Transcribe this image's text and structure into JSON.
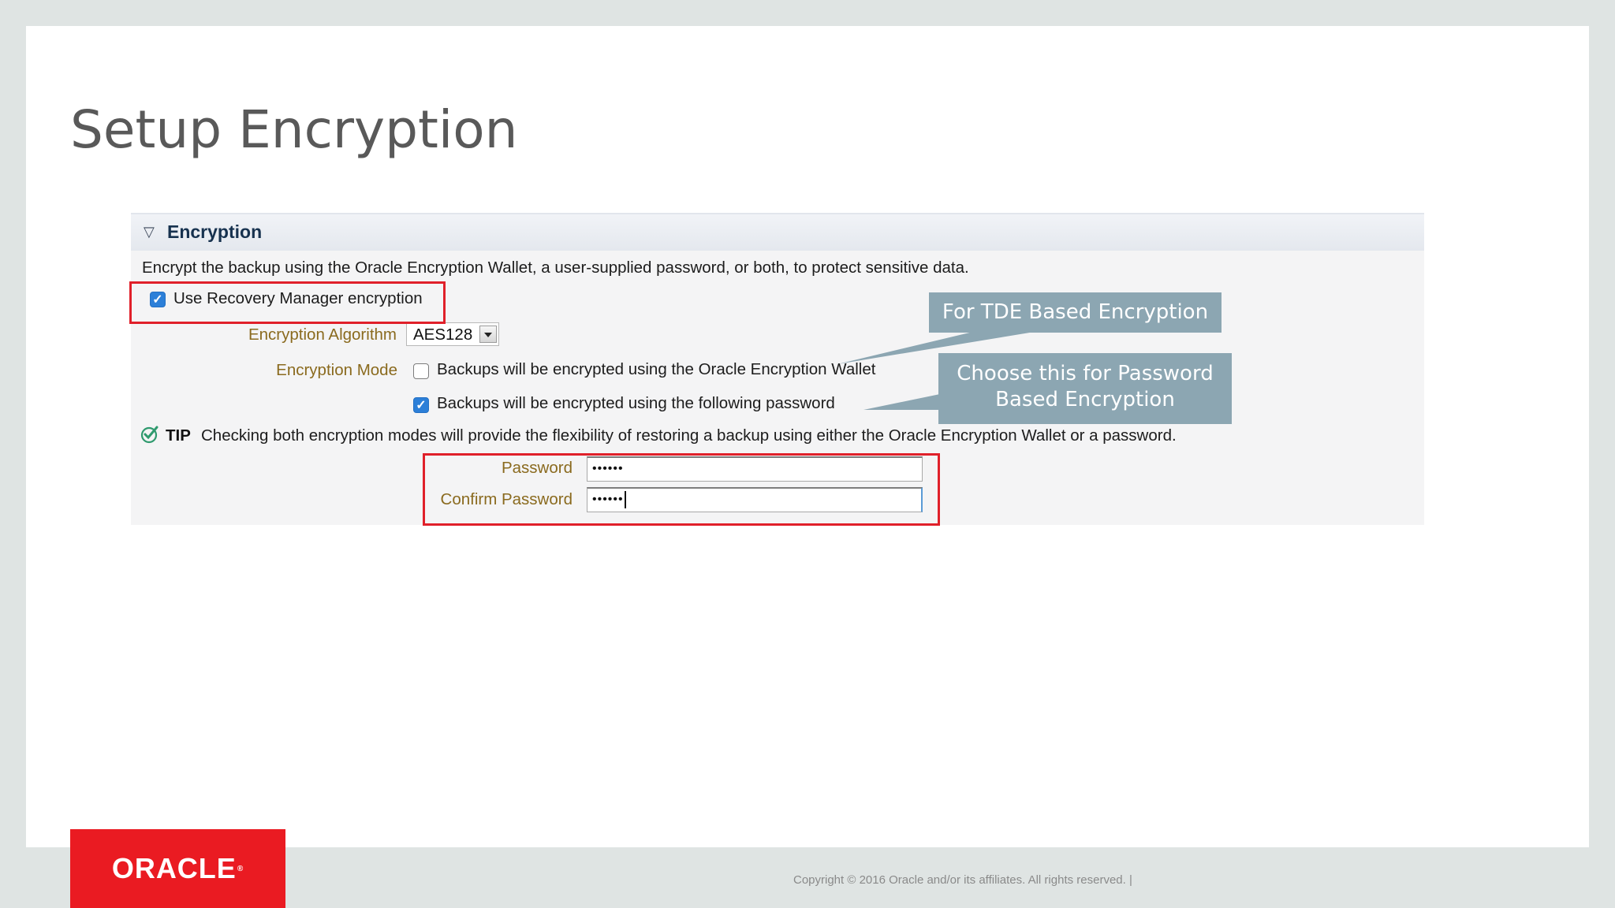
{
  "slide": {
    "title": "Setup Encryption"
  },
  "panel": {
    "section_title": "Encryption",
    "description": "Encrypt the backup using the Oracle Encryption Wallet, a user-supplied password, or both, to protect sensitive data.",
    "use_rman_encryption": {
      "label": "Use Recovery Manager encryption",
      "checked": true
    },
    "encryption_algorithm": {
      "label": "Encryption Algorithm",
      "value": "AES128"
    },
    "encryption_mode": {
      "label": "Encryption Mode",
      "options": [
        {
          "label": "Backups will be encrypted using the Oracle Encryption Wallet",
          "checked": false
        },
        {
          "label": "Backups will be encrypted using the following password",
          "checked": true
        }
      ]
    },
    "tip": {
      "keyword": "TIP",
      "text": "Checking both encryption modes will provide the flexibility of restoring a backup using either the Oracle Encryption Wallet or a password."
    },
    "password": {
      "label": "Password",
      "value": "••••••"
    },
    "confirm_password": {
      "label": "Confirm Password",
      "value": "••••••"
    }
  },
  "callouts": {
    "tde": "For TDE Based Encryption",
    "password_line1": "Choose this for Password",
    "password_line2": "Based Encryption"
  },
  "footer": {
    "logo_text": "ORACLE",
    "logo_mark": "®",
    "copyright": "Copyright © 2016 Oracle and/or its affiliates. All rights reserved.  |"
  },
  "colors": {
    "highlight_red": "#e0202a",
    "callout_bg": "#8ca6b2",
    "oracle_red": "#ea1b22",
    "checkbox_blue": "#2c7fd8"
  },
  "icons": [
    "disclosure-triangle-icon",
    "tip-checkmark-icon",
    "dropdown-arrow-icon"
  ]
}
